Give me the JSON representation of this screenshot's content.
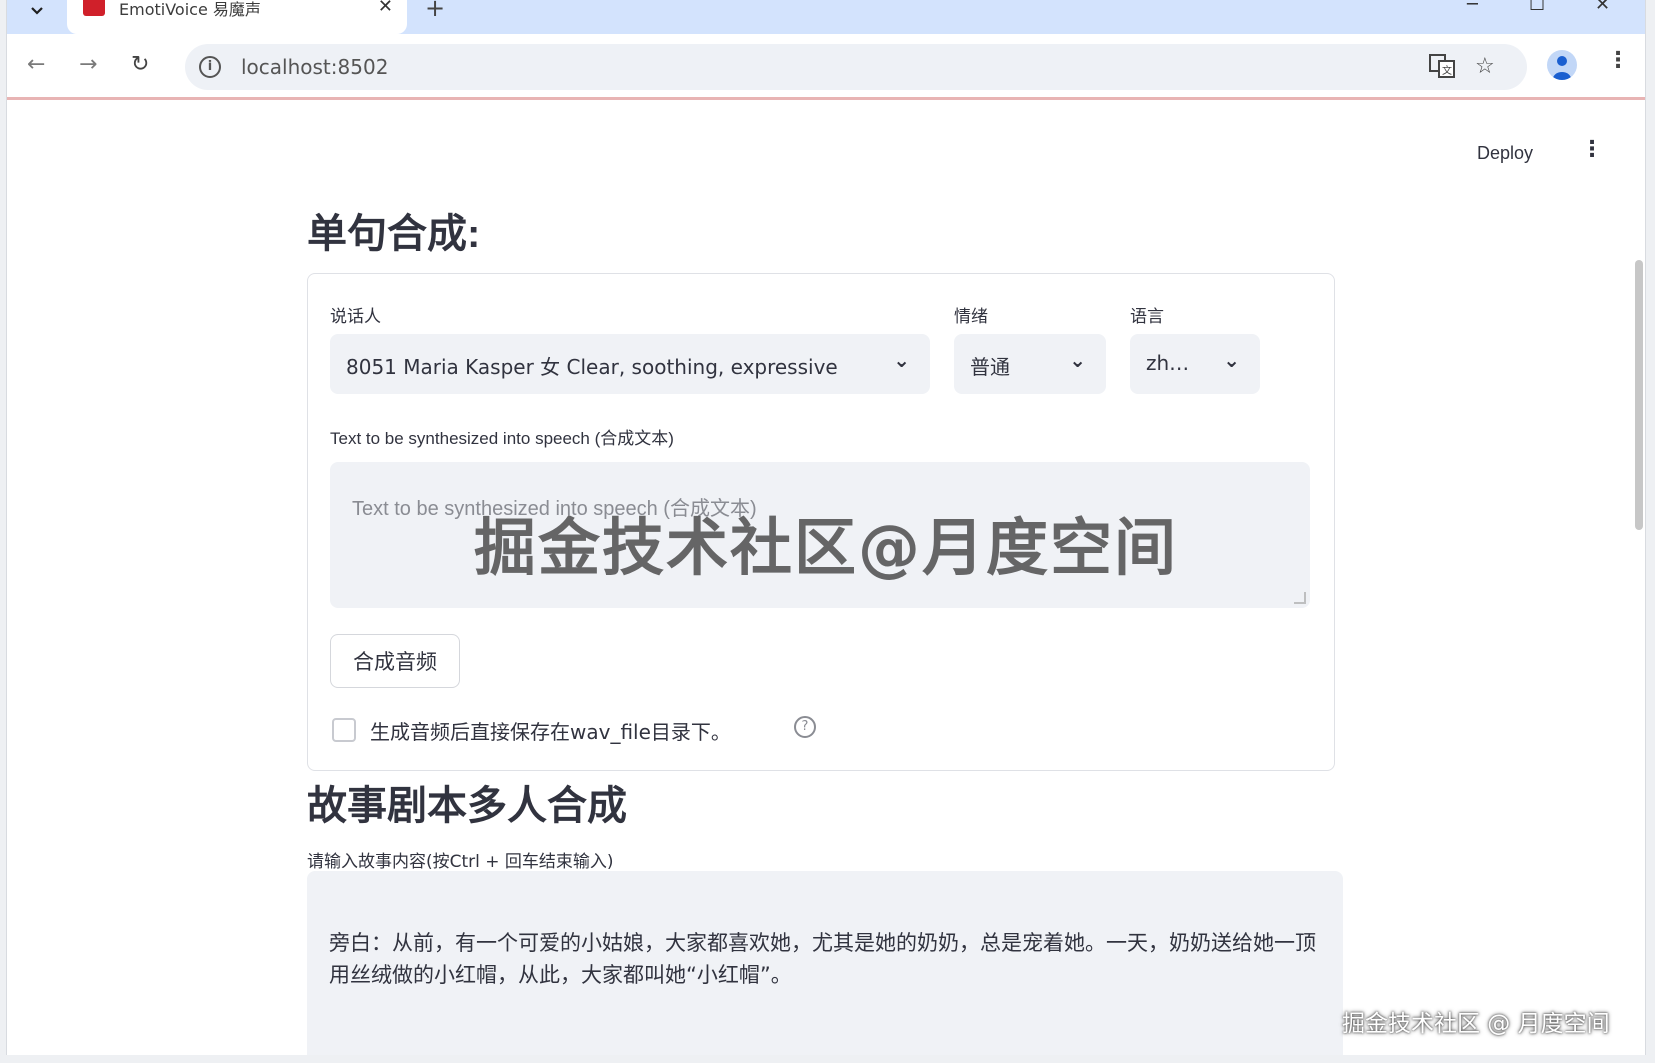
{
  "browser": {
    "tab_title": "EmotiVoice 易魔声",
    "tab_close": "✕",
    "new_tab": "+",
    "url": "localhost:8502"
  },
  "header": {
    "deploy_label": "Deploy"
  },
  "single": {
    "title": "单句合成:",
    "speaker_label": "说话人",
    "speaker_value": "8051 Maria Kasper 女 Clear, soothing, expressive",
    "emotion_label": "情绪",
    "emotion_value": "普通",
    "language_label": "语言",
    "language_value": "zh…",
    "text_label": "Text to be synthesized into speech (合成文本)",
    "text_placeholder": "Text to be synthesized into speech (合成文本)",
    "synth_button": "合成音频",
    "save_checkbox_label": "生成音频后直接保存在wav_file目录下。",
    "save_checked": false
  },
  "story": {
    "title": "故事剧本多人合成",
    "input_label": "请输入故事内容(按Ctrl + 回车结束输入)",
    "content": "旁白：从前，有一个可爱的小姑娘，大家都喜欢她，尤其是她的奶奶，总是宠着她。一天，奶奶送给她一顶用丝绒做的小红帽，从此，大家都叫她“小红帽”。"
  },
  "watermark": "掘金技术社区@月度空间",
  "corner_watermark": "掘金技术社区 @ 月度空间",
  "colors": {
    "tab_strip": "#d3e3fd",
    "input_bg": "#f0f2f6",
    "text": "#31333f"
  }
}
